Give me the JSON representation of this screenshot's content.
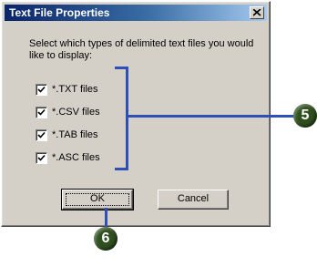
{
  "dialog": {
    "title": "Text File Properties",
    "instructions": "Select which types of delimited text files you would like to display:",
    "options": [
      {
        "label": "*.TXT files",
        "checked": true
      },
      {
        "label": "*.CSV files",
        "checked": true
      },
      {
        "label": "*.TAB files",
        "checked": true
      },
      {
        "label": "*.ASC files",
        "checked": true
      }
    ],
    "ok_label": "OK",
    "cancel_label": "Cancel"
  },
  "callouts": {
    "step_5": "5",
    "step_6": "6"
  },
  "colors": {
    "dialog_face": "#d4d0c8",
    "titlebar_start": "#0a246a",
    "titlebar_end": "#a6caf0",
    "callout_line": "#2e4fb3",
    "callout_badge": "#2f4f1f"
  },
  "icons": {
    "close": "close-icon",
    "check": "check-icon"
  }
}
